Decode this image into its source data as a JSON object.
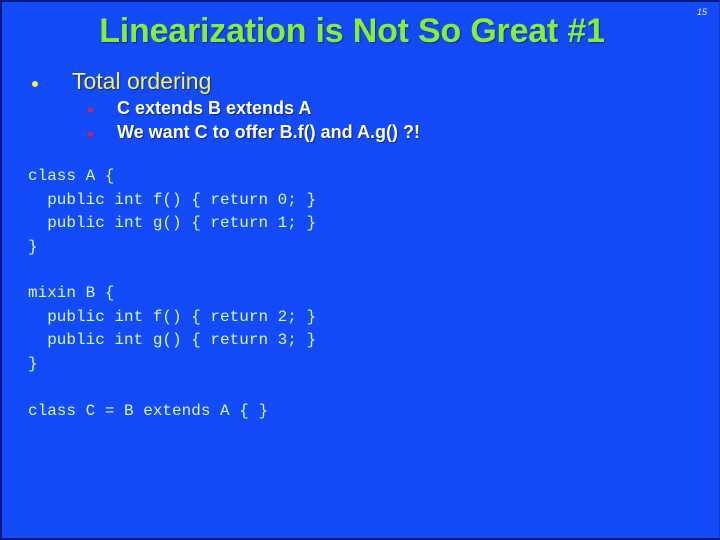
{
  "slide": {
    "title": "Linearization is Not So Great #1",
    "page_number": "15",
    "bullets": [
      {
        "text": "Total ordering",
        "sub_bullets": [
          "C extends B extends  A",
          "We want C to offer B.f() and A.g() ?!"
        ]
      }
    ],
    "code_blocks": [
      "class A {\n  public int f() { return 0; }\n  public int g() { return 1; }\n}",
      "mixin B {\n  public int f() { return 2; }\n  public int g() { return 3; }\n}",
      "class C = B extends A { }"
    ],
    "colors": {
      "background": "#134bf9",
      "title": "#86ee3a",
      "bullet_text": "#f2f25a",
      "sub_bullet_text": "#ffffff",
      "sub_bullet_marker": "#d81c5a",
      "code_text": "#d8f4d0"
    }
  }
}
